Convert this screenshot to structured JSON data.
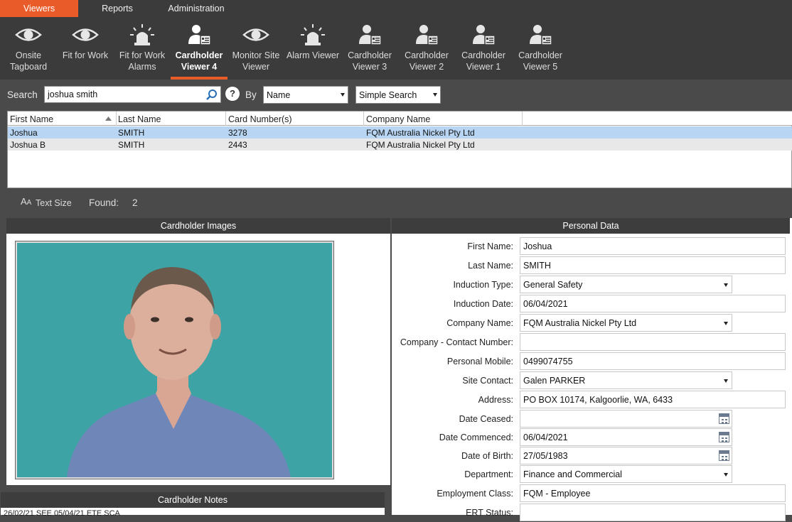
{
  "top_nav": {
    "viewers": "Viewers",
    "reports": "Reports",
    "administration": "Administration"
  },
  "toolbar": [
    {
      "line1": "Onsite",
      "line2": "Tagboard",
      "icon": "eye-icon"
    },
    {
      "line1": "Fit for Work",
      "line2": "",
      "icon": "eye-icon"
    },
    {
      "line1": "Fit for Work",
      "line2": "Alarms",
      "icon": "alarm-light-icon"
    },
    {
      "line1": "Cardholder",
      "line2": "Viewer 4",
      "icon": "cardholder-icon"
    },
    {
      "line1": "Monitor Site",
      "line2": "Viewer",
      "icon": "eye-icon"
    },
    {
      "line1": "Alarm Viewer",
      "line2": "",
      "icon": "alarm-light-icon"
    },
    {
      "line1": "Cardholder",
      "line2": "Viewer 3",
      "icon": "cardholder-icon"
    },
    {
      "line1": "Cardholder",
      "line2": "Viewer 2",
      "icon": "cardholder-icon"
    },
    {
      "line1": "Cardholder",
      "line2": "Viewer 1",
      "icon": "cardholder-icon"
    },
    {
      "line1": "Cardholder",
      "line2": "Viewer 5",
      "icon": "cardholder-icon"
    }
  ],
  "search": {
    "label": "Search",
    "value": "joshua smith",
    "help": "?",
    "by_label": "By",
    "by_value": "Name",
    "mode_value": "Simple Search"
  },
  "grid": {
    "headers": [
      "First Name",
      "Last Name",
      "Card Number(s)",
      "Company Name"
    ],
    "rows": [
      [
        "Joshua",
        "SMITH",
        "3278",
        "FQM Australia Nickel Pty Ltd"
      ],
      [
        "Joshua B",
        "SMITH",
        "2443",
        "FQM Australia Nickel Pty Ltd"
      ]
    ]
  },
  "info": {
    "text_size": "Text Size",
    "found_label": "Found:",
    "found_count": "2"
  },
  "images_panel": {
    "title": "Cardholder Images"
  },
  "notes_panel": {
    "title": "Cardholder Notes",
    "text": "26/02/21 SEE 05/04/21 ETE SCA"
  },
  "personal": {
    "title": "Personal Data",
    "fields": [
      {
        "label": "First Name:",
        "value": "Joshua"
      },
      {
        "label": "Last Name:",
        "value": "SMITH"
      },
      {
        "label": "Induction Type:",
        "value": "General Safety"
      },
      {
        "label": "Induction Date:",
        "value": "06/04/2021"
      },
      {
        "label": "Company Name:",
        "value": "FQM Australia Nickel Pty Ltd"
      },
      {
        "label": "Company - Contact Number:",
        "value": ""
      },
      {
        "label": "Personal Mobile:",
        "value": "0499074755"
      },
      {
        "label": "Site Contact:",
        "value": "Galen PARKER"
      },
      {
        "label": "Address:",
        "value": "PO BOX 10174, Kalgoorlie, WA, 6433"
      },
      {
        "label": "Date Ceased:",
        "value": ""
      },
      {
        "label": "Date Commenced:",
        "value": "06/04/2021"
      },
      {
        "label": "Date of Birth:",
        "value": "27/05/1983"
      },
      {
        "label": "Department:",
        "value": "Finance and Commercial"
      },
      {
        "label": "Employment Class:",
        "value": "FQM - Employee"
      },
      {
        "label": "ERT Status:",
        "value": ""
      }
    ]
  },
  "colors": {
    "accent": "#ea5b2a",
    "selected_row": "#b8d6f3",
    "toolbar_bg": "#3b3b3b"
  }
}
